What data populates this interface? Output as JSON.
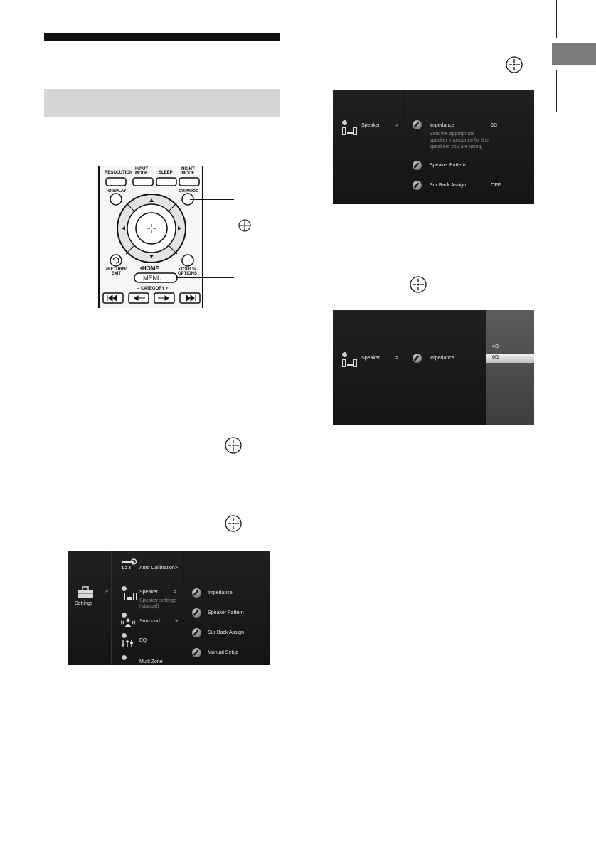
{
  "remote": {
    "buttons": {
      "resolution": "RESOLUTION",
      "input_mode": "INPUT\nMODE",
      "sleep": "SLEEP",
      "night_mode": "NIGHT\nMODE",
      "display": "DISPLAY",
      "gui_mode": "GUI MODE",
      "return_exit": "RETURN/\nEXIT",
      "home": "HOME",
      "menu": "MENU",
      "tools_options": "TOOLS/\nOPTIONS",
      "category": "CATEGORY"
    }
  },
  "screen1": {
    "left_item": "Speaker",
    "arrow": ">",
    "selected": "Impedance",
    "selected_value": "6Ω",
    "description": [
      "Sets the appropriate",
      "speaker impedance for the",
      "speakers you are using."
    ],
    "items": [
      {
        "label": "Speaker Pattern",
        "value": ""
      },
      {
        "label": "Sur Back Assign",
        "value": "OFF"
      }
    ]
  },
  "screen2": {
    "left_item": "Speaker",
    "arrow": ">",
    "selected": "Impedance",
    "options": [
      "4Ω",
      "6Ω"
    ],
    "selected_option": "6Ω"
  },
  "screen3": {
    "root": "Settings",
    "arrow": ">",
    "menu": [
      {
        "label": "Auto Calibration",
        "arrow": ">"
      },
      {
        "label": "Speaker",
        "arrow": ">",
        "sub": "Speaker settings\n(Manual)"
      },
      {
        "label": "Surround",
        "arrow": ">"
      },
      {
        "label": "EQ",
        "arrow": ""
      },
      {
        "label": "Multi Zone",
        "arrow": ""
      }
    ],
    "calib_icon_text": "1-2-3",
    "submenu": [
      "Impedance",
      "Speaker Pattern",
      "Sur Back Assign",
      "Manual Setup"
    ]
  },
  "colors": {
    "screen_bg": "#1a1a1a",
    "grey_band": "#d6d6d6",
    "side_tab": "#7a7a7a"
  }
}
